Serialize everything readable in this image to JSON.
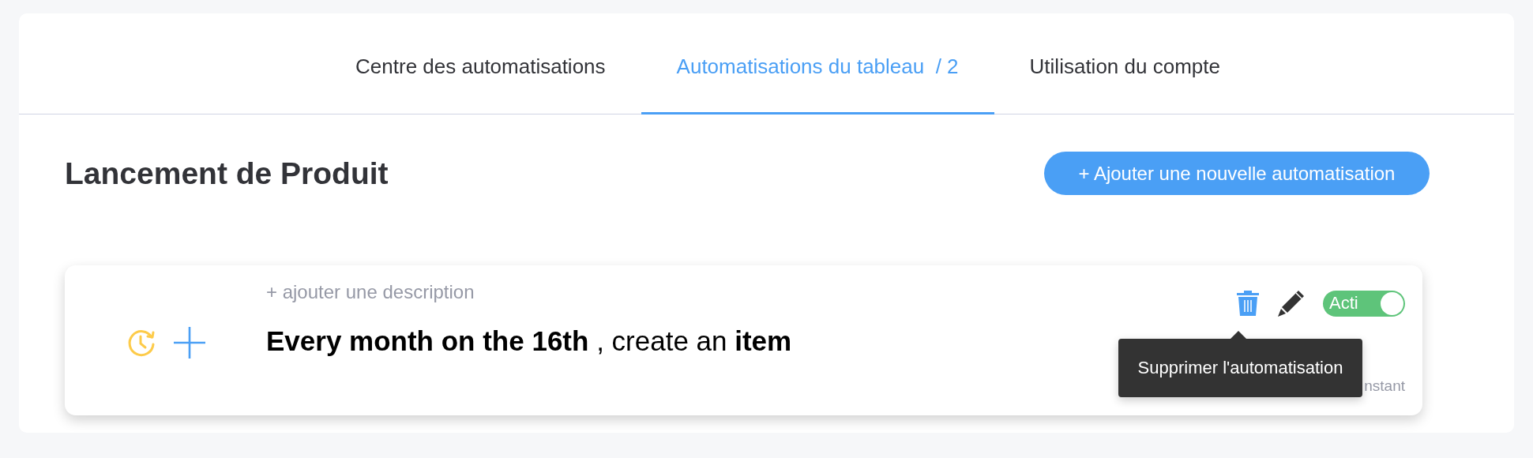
{
  "tabs": [
    {
      "label": "Centre des automatisations",
      "selected": false
    },
    {
      "label": "Automatisations du tableau  / 2",
      "selected": true
    },
    {
      "label": "Utilisation du compte",
      "selected": false
    }
  ],
  "board": {
    "title": "Lancement de Produit",
    "add_button": "+ Ajouter une nouvelle automatisation"
  },
  "automations": [
    {
      "description_placeholder": "+ ajouter une description",
      "recipe": "**Every month on the 16th** , create an **item**",
      "toggle": {
        "label": "Acti",
        "on": true
      },
      "footer": "nstant",
      "tooltip": "Supprimer l'automatisation"
    }
  ]
}
